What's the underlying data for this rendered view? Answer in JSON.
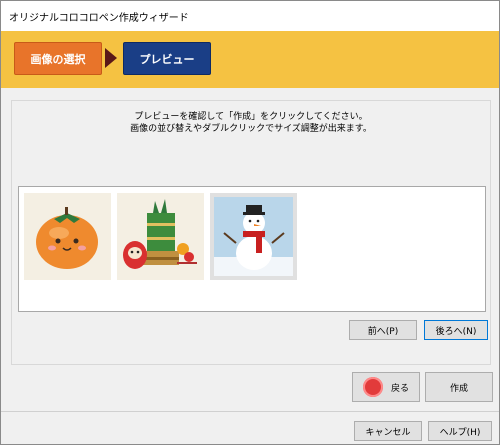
{
  "window": {
    "title": "オリジナルコロコロペン作成ウィザード"
  },
  "steps": [
    {
      "label": "画像の選択"
    },
    {
      "label": "プレビュー"
    }
  ],
  "instructions": {
    "line1": "プレビューを確認して「作成」をクリックしてください。",
    "line2": "画像の並び替えやダブルクリックでサイズ調整が出来ます。"
  },
  "thumbnails": [
    {
      "name": "persimmon"
    },
    {
      "name": "new-year-decoration"
    },
    {
      "name": "snowman"
    }
  ],
  "nav": {
    "prev_label": "前へ(P)",
    "next_label": "後ろへ(N)"
  },
  "actions": {
    "back_label": "戻る",
    "create_label": "作成"
  },
  "footer": {
    "cancel_label": "キャンセル",
    "help_label": "ヘルプ(H)"
  },
  "colors": {
    "step_active": "#e8742a",
    "step_current": "#1a3e86",
    "stepbar": "#f5c242"
  }
}
